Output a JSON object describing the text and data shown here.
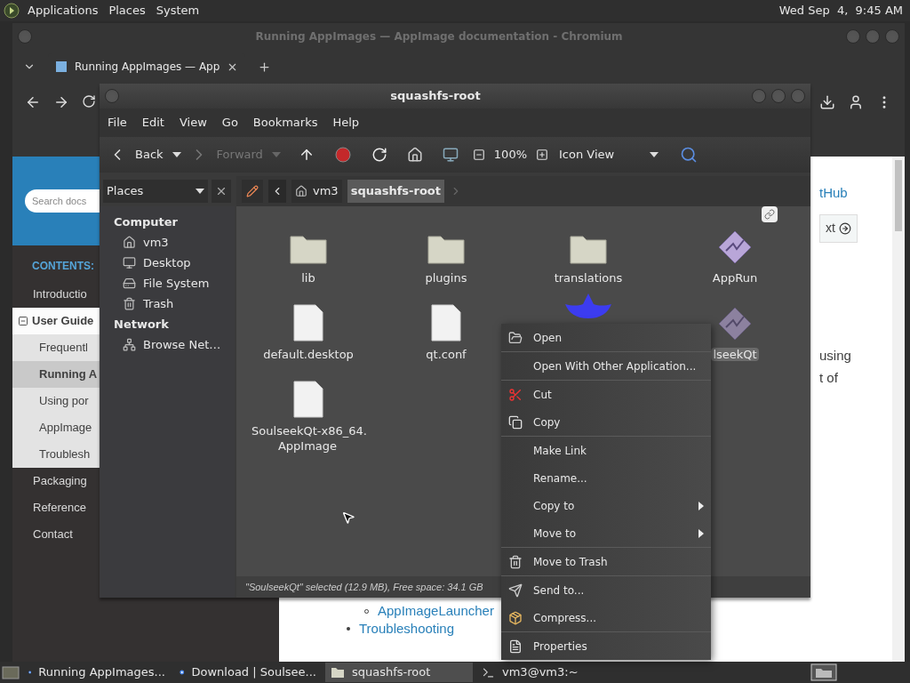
{
  "top_panel": {
    "menus": [
      "Applications",
      "Places",
      "System"
    ],
    "clock": "Wed Sep  4,  9:45 AM"
  },
  "browser": {
    "title": "Running AppImages — AppImage documentation - Chromium",
    "tabs": [
      {
        "label": "Running AppImages — App",
        "selected": true
      }
    ],
    "page": {
      "search": {
        "placeholder": "Search docs"
      },
      "contents_heading": "CONTENTS:",
      "nav": [
        {
          "label": "Introductio",
          "selected": false,
          "expanded": false
        },
        {
          "label": "User Guide",
          "selected": false,
          "expanded": true,
          "children": [
            {
              "label": "Frequentl",
              "selected": false
            },
            {
              "label": "Running A",
              "selected": true
            },
            {
              "label": "Using por",
              "selected": false
            },
            {
              "label": "AppImage",
              "selected": false
            },
            {
              "label": "Troublesh",
              "selected": false
            }
          ]
        },
        {
          "label": "Packaging",
          "selected": false,
          "expanded": false
        },
        {
          "label": "Reference",
          "selected": false,
          "expanded": false
        },
        {
          "label": "Contact",
          "selected": false,
          "expanded": false
        }
      ],
      "link": "tHub",
      "next_button": "xt",
      "text_lines": [
        "using",
        "t of"
      ],
      "bullets": [
        {
          "children": [
            {
              "label": "AppImageLauncher"
            }
          ]
        },
        {
          "label": "Troubleshooting"
        }
      ]
    }
  },
  "file_manager": {
    "title": "squashfs-root",
    "menus": [
      "File",
      "Edit",
      "View",
      "Go",
      "Bookmarks",
      "Help"
    ],
    "toolbar": {
      "back": {
        "label": "Back",
        "disabled": false
      },
      "forward": {
        "label": "Forward",
        "disabled": true
      },
      "zoom": "100%",
      "view": "Icon View"
    },
    "side_pane": {
      "selector": "Places",
      "sections": [
        {
          "heading": "Computer",
          "items": [
            {
              "label": "vm3",
              "kind": "home"
            },
            {
              "label": "Desktop",
              "kind": "desktop"
            },
            {
              "label": "File System",
              "kind": "drive"
            },
            {
              "label": "Trash",
              "kind": "trash"
            }
          ]
        },
        {
          "heading": "Network",
          "items": [
            {
              "label": "Browse Net…",
              "kind": "network"
            }
          ]
        }
      ]
    },
    "path": [
      {
        "label": "vm3",
        "selected": false
      },
      {
        "label": "squashfs-root",
        "selected": true
      }
    ],
    "files": [
      {
        "name": "lib",
        "kind": "folder",
        "selected": false
      },
      {
        "name": "plugins",
        "kind": "folder",
        "selected": false
      },
      {
        "name": "translations",
        "kind": "folder",
        "selected": false
      },
      {
        "name": "AppRun",
        "kind": "app",
        "selected": false,
        "link": true
      },
      {
        "name": "default.desktop",
        "kind": "text",
        "selected": false
      },
      {
        "name": "qt.conf",
        "kind": "text",
        "selected": false
      },
      {
        "kind": "boat",
        "selected": false
      },
      {
        "name": "lseekQt",
        "kind": "app",
        "selected": true
      },
      {
        "name": "SoulseekQt-x86_64.AppImage",
        "kind": "text",
        "selected": false
      }
    ],
    "status": "\"SoulseekQt\" selected (12.9 MB), Free space: 34.1 GB"
  },
  "context_menu": [
    [
      {
        "label": "Open",
        "submenu": false
      }
    ],
    [
      {
        "label": "Open With Other Application...",
        "submenu": false
      }
    ],
    [
      {
        "label": "Cut",
        "submenu": false
      },
      {
        "label": "Copy",
        "submenu": false
      }
    ],
    [
      {
        "label": "Make Link",
        "submenu": false
      },
      {
        "label": "Rename...",
        "submenu": false
      },
      {
        "label": "Copy to",
        "submenu": true
      },
      {
        "label": "Move to",
        "submenu": true
      }
    ],
    [
      {
        "label": "Move to Trash",
        "submenu": false
      }
    ],
    [
      {
        "label": "Send to...",
        "submenu": false
      },
      {
        "label": "Compress...",
        "submenu": false
      }
    ],
    [
      {
        "label": "Properties",
        "submenu": false
      }
    ]
  ],
  "taskbar": [
    {
      "label": "Running AppImages...",
      "kind": "browser",
      "selected": false
    },
    {
      "label": "Download | Soulsee...",
      "kind": "browser",
      "selected": false
    },
    {
      "label": "squashfs-root",
      "kind": "folder",
      "selected": true
    },
    {
      "label": "vm3@vm3:~",
      "kind": "terminal",
      "selected": false
    }
  ]
}
